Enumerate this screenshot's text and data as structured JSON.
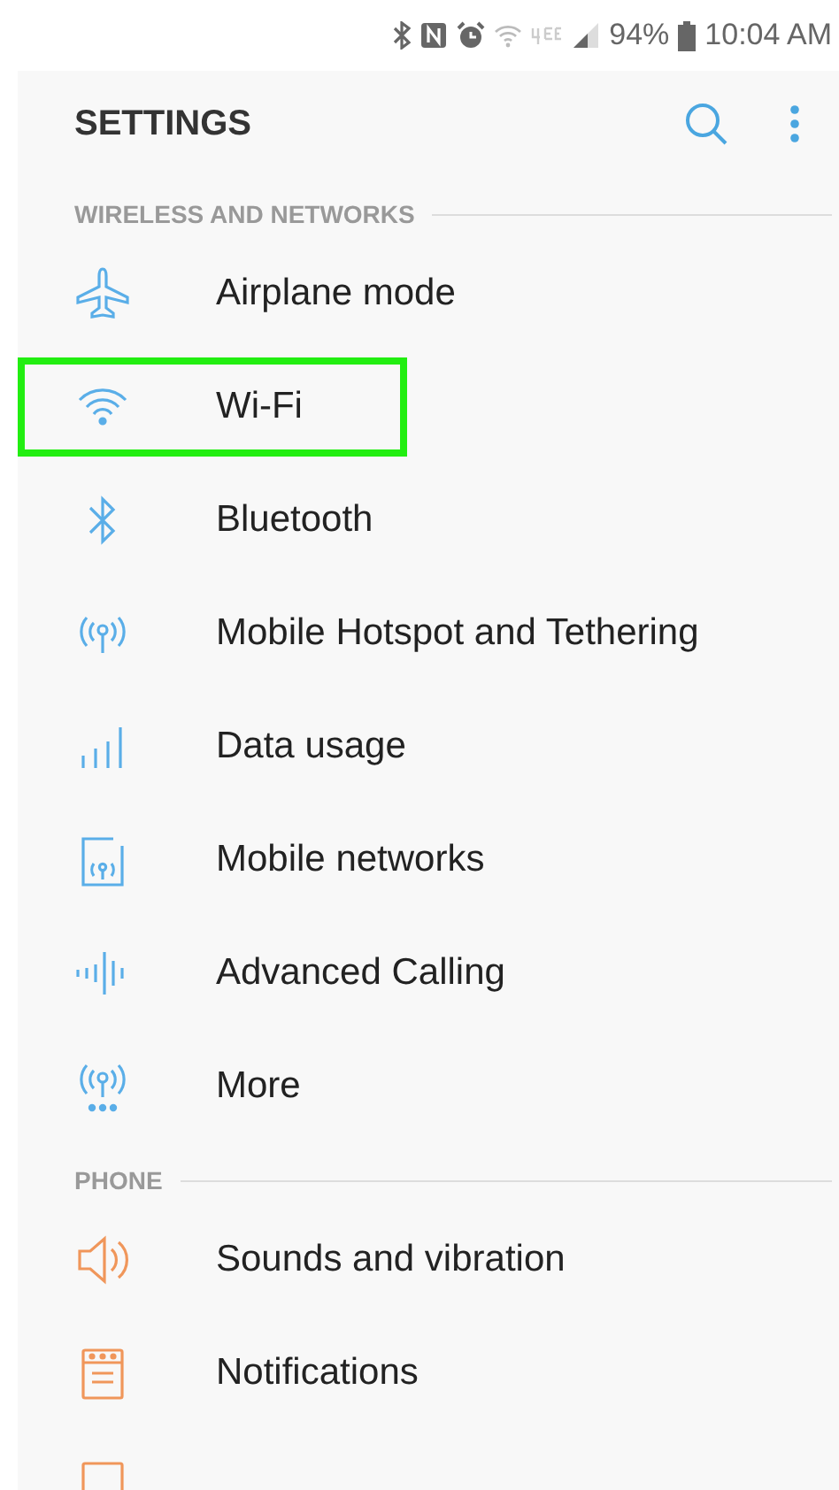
{
  "status_bar": {
    "battery": "94%",
    "time": "10:04 AM"
  },
  "header": {
    "title": "SETTINGS"
  },
  "sections": [
    {
      "title": "WIRELESS AND NETWORKS",
      "color": "#5aaee8",
      "items": [
        {
          "kind": "airplane",
          "label": "Airplane mode",
          "highlighted": false
        },
        {
          "kind": "wifi",
          "label": "Wi-Fi",
          "highlighted": true
        },
        {
          "kind": "bluetooth",
          "label": "Bluetooth",
          "highlighted": false
        },
        {
          "kind": "hotspot",
          "label": "Mobile Hotspot and Tethering",
          "highlighted": false
        },
        {
          "kind": "bars",
          "label": "Data usage",
          "highlighted": false
        },
        {
          "kind": "network",
          "label": "Mobile networks",
          "highlighted": false
        },
        {
          "kind": "wave",
          "label": "Advanced Calling",
          "highlighted": false
        },
        {
          "kind": "more",
          "label": "More",
          "highlighted": false
        }
      ]
    },
    {
      "title": "PHONE",
      "color": "#f0965a",
      "items": [
        {
          "kind": "speaker",
          "label": "Sounds and vibration",
          "highlighted": false
        },
        {
          "kind": "notification",
          "label": "Notifications",
          "highlighted": false
        },
        {
          "kind": "display",
          "highlighted": false
        }
      ]
    }
  ]
}
